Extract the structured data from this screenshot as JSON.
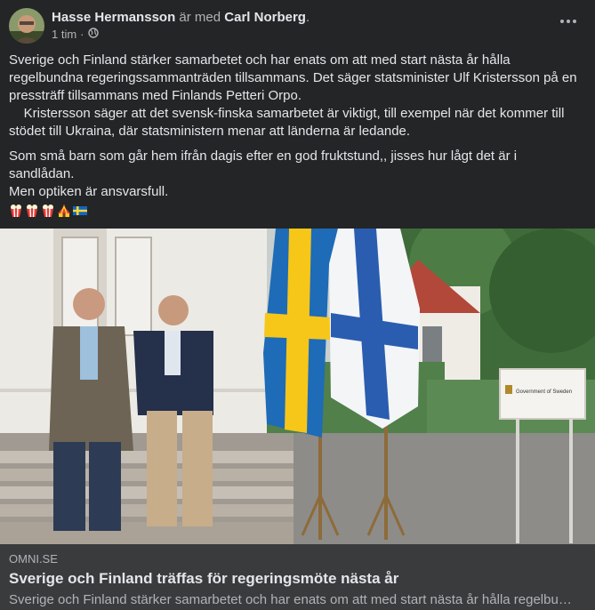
{
  "post": {
    "author": "Hasse Hermansson",
    "with_text": " är med ",
    "tagged": "Carl Norberg",
    "tagged_suffix": ".",
    "time": "1 tim",
    "audience_icon": "globe-icon",
    "more_icon": "more-horizontal-icon",
    "paragraphs": [
      "Sverige och Finland stärker samarbetet och har enats om att med start nästa år hålla regelbundna regeringssammanträden tillsammans. Det säger statsminister Ulf Kristersson på en pressträff tillsammans med Finlands Petteri Orpo.",
      "    Kristersson säger att det svensk-finska samarbetet är viktigt, till exempel när det kommer till stödet till Ukraina, där statsministern menar att länderna är ledande.",
      "Som små barn som går hem ifrån dagis efter en god fruktstund,, jisses hur lågt det är i sandlådan.",
      "Men optiken är ansvarsfull."
    ],
    "emojis": [
      "popcorn",
      "popcorn",
      "popcorn",
      "circus-tent",
      "sweden-flag"
    ]
  },
  "photo": {
    "sign_text": "Government of Sweden"
  },
  "link": {
    "domain": "OMNI.SE",
    "title": "Sverige och Finland träffas för regeringsmöte nästa år",
    "description": "Sverige och Finland stärker samarbetet och har enats om att med start nästa år hålla regelbundna regeringssammanträden tillsammans."
  }
}
